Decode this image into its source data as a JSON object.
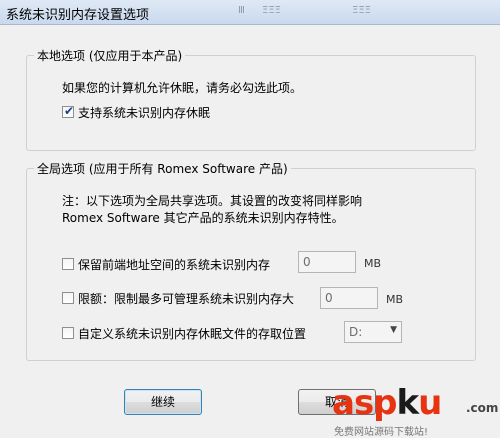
{
  "window": {
    "title": "系统未识别内存设置选项",
    "ghost_menu": [
      "Ⅲ",
      "ΞΞΞ",
      "ΞΞΞ"
    ]
  },
  "local_group": {
    "legend": "本地选项 (仅应用于本产品)",
    "hint": "如果您的计算机允许休眠，请务必勾选此项。",
    "checkbox": {
      "label": "支持系统未识别内存休眠",
      "checked": true
    }
  },
  "global_group": {
    "legend": "全局选项 (应用于所有 Romex Software 产品)",
    "note_line1": "注：以下选项为全局共享选项。其设置的改变将同样影响",
    "note_line2": "Romex Software 其它产品的系统未识别内存特性。",
    "reserve": {
      "label": "保留前端地址空间的系统未识别内存",
      "value": "0",
      "unit": "MB",
      "checked": false
    },
    "limit": {
      "label": "限额：限制最多可管理系统未识别内存大",
      "value": "0",
      "unit": "MB",
      "checked": false
    },
    "hibernate_location": {
      "label": "自定义系统未识别内存休眠文件的存取位置",
      "value": "D:",
      "checked": false
    }
  },
  "buttons": {
    "continue": "继续",
    "cancel": "取消"
  },
  "watermark": {
    "logo_a": "asp",
    "logo_b": "k",
    "logo_c": "u",
    "suffix": ".com",
    "subtitle": "免费网站源码下载站!"
  },
  "colors": {
    "checkmark": "#1a3e8c",
    "watermark_red": "#e63312"
  }
}
